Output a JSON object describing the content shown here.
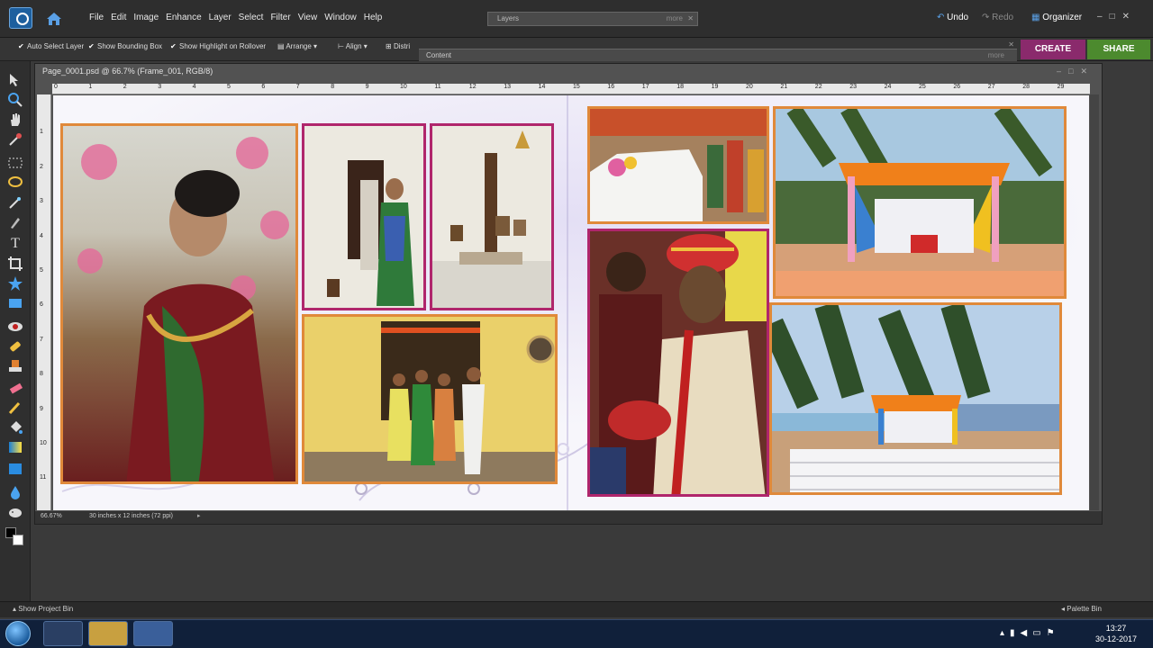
{
  "menubar": {
    "menus": [
      "File",
      "Edit",
      "Image",
      "Enhance",
      "Layer",
      "Select",
      "Filter",
      "View",
      "Window",
      "Help"
    ],
    "layers_panel_tab": "Layers",
    "layers_more": "more",
    "undo": "Undo",
    "redo": "Redo",
    "organizer": "Organizer"
  },
  "optbar": {
    "auto_select": "Auto Select Layer",
    "bounding_box": "Show Bounding Box",
    "highlight": "Show Highlight on Rollover",
    "arrange": "Arrange",
    "align": "Align",
    "distribute": "Distri",
    "content_tab": "Content",
    "content_more": "more",
    "create": "CREATE",
    "share": "SHARE"
  },
  "document": {
    "title": "Page_0001.psd @ 66.7% (Frame_001, RGB/8)",
    "zoom": "66.67%",
    "doc_info": "30 inches x 12 inches (72 ppi)",
    "ruler_h": [
      "0",
      "1",
      "2",
      "3",
      "4",
      "5",
      "6",
      "7",
      "8",
      "9",
      "10",
      "11",
      "12",
      "13",
      "14",
      "15",
      "16",
      "17",
      "18",
      "19",
      "20",
      "21",
      "22",
      "23",
      "24",
      "25",
      "26",
      "27",
      "28",
      "29"
    ],
    "ruler_v": [
      "1",
      "2",
      "3",
      "4",
      "5",
      "6",
      "7",
      "8",
      "9",
      "10",
      "11"
    ]
  },
  "bottom": {
    "show_project_bin": "Show Project Bin",
    "palette_bin": "Palette Bin"
  },
  "taskbar": {
    "time": "13:27",
    "date": "30-12-2017"
  },
  "colors": {
    "frame_orange": "#e0893a",
    "frame_pink": "#b0266c",
    "create": "#8a2a6c",
    "share": "#4c8a2e"
  }
}
